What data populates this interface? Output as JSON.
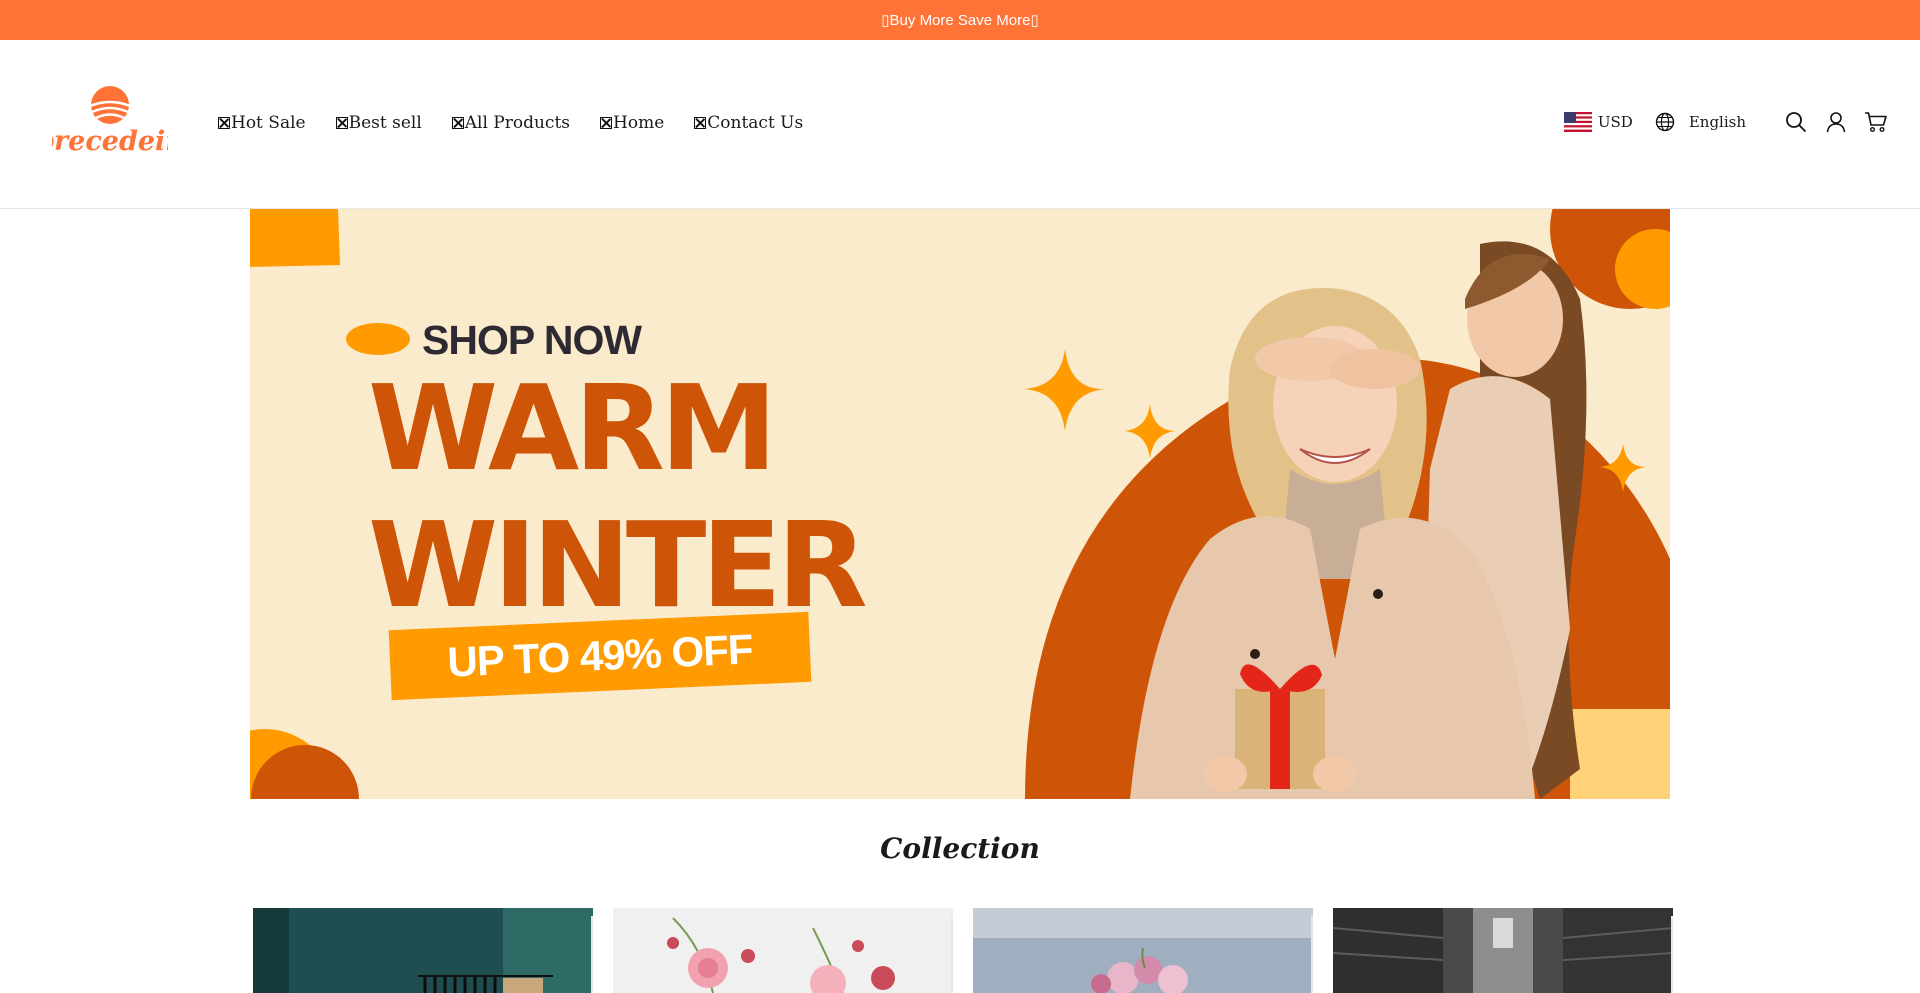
{
  "announcement": {
    "text": "▯Buy More Save More▯"
  },
  "header": {
    "logo_text": "precedein",
    "nav": [
      {
        "label": "Hot Sale"
      },
      {
        "label": "Best sell"
      },
      {
        "label": "All Products"
      },
      {
        "label": "Home"
      },
      {
        "label": "Contact Us"
      }
    ],
    "currency": {
      "label": "USD",
      "flag": "us-flag-icon"
    },
    "language": {
      "label": "English",
      "icon": "globe-icon"
    },
    "icons": [
      "search-icon",
      "account-icon",
      "cart-icon"
    ]
  },
  "hero": {
    "kicker": "SHOP NOW",
    "headline_1": "WARM",
    "headline_2": "WINTER",
    "promo": "UP TO 49% OFF",
    "colors": {
      "background": "#F9EBCB",
      "accent": "#CE5407",
      "orange": "#FF9A00"
    }
  },
  "collection": {
    "title": "Collection",
    "cards": [
      {
        "image": "clothing-rack-photo"
      },
      {
        "image": "pink-flowers-photo"
      },
      {
        "image": "flower-vase-photo"
      },
      {
        "image": "warehouse-photo"
      }
    ]
  },
  "colors": {
    "brand": "#FF7337"
  }
}
